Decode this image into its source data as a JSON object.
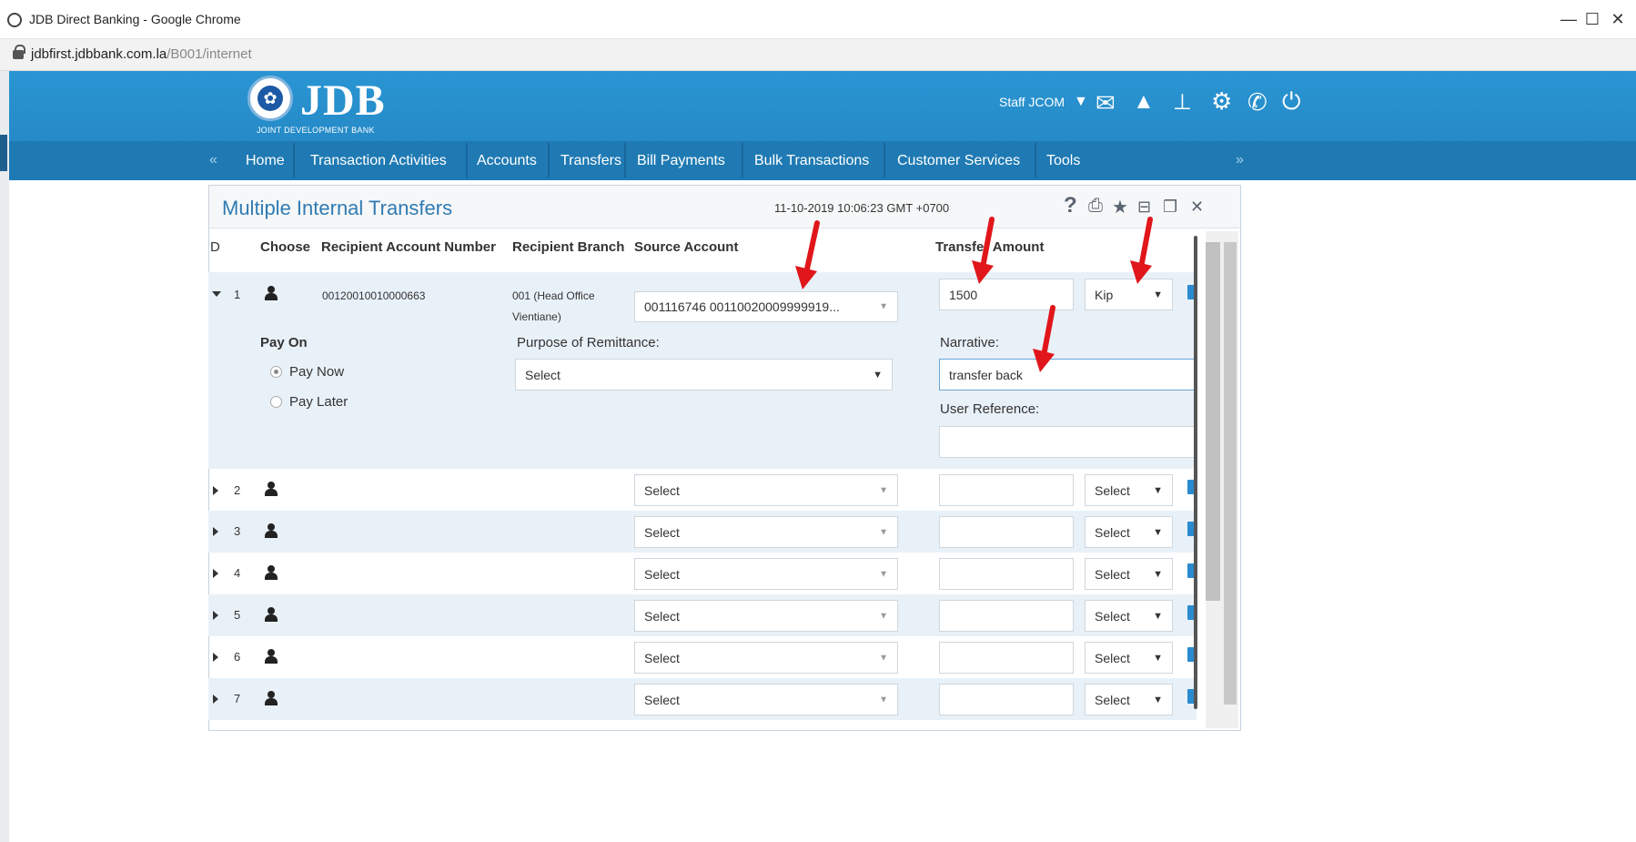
{
  "browser": {
    "title": "JDB Direct Banking - Google Chrome",
    "url_host": "jdbfirst.jdbbank.com.la",
    "url_path": "/B001/internet",
    "controls": [
      "—",
      "☐",
      "✕"
    ]
  },
  "header": {
    "logo_text": "JDB",
    "logo_subtitle": "JOINT DEVELOPMENT BANK",
    "user": "Staff JCOM",
    "icons": [
      "caret-down-icon",
      "mail-icon",
      "warning-icon",
      "sitemap-icon",
      "gear-icon",
      "phone-icon",
      "power-icon"
    ]
  },
  "menu": {
    "prev": "«",
    "next": "»",
    "items": [
      "Home",
      "Transaction Activities",
      "Accounts",
      "Transfers",
      "Bill Payments",
      "Bulk Transactions",
      "Customer Services",
      "Tools"
    ]
  },
  "panel": {
    "title": "Multiple Internal Transfers",
    "timestamp": "11-10-2019 10:06:23 GMT +0700",
    "tools": [
      "?",
      "print-icon",
      "star-icon",
      "minimize-icon",
      "window-icon",
      "close-icon"
    ]
  },
  "columns": {
    "id": "D",
    "choose": "Choose",
    "recipient_account": "Recipient Account Number",
    "recipient_branch": "Recipient Branch",
    "source_account": "Source Account",
    "transfer_amount": "Transfer Amount"
  },
  "expanded_row": {
    "num": "1",
    "recipient_account": "00120010010000663",
    "branch_line1": "001 (Head Office",
    "branch_line2": "Vientiane)",
    "source_account": "001116746 00110020009999919...",
    "amount": "1500",
    "currency": "Kip",
    "pay_on_label": "Pay On",
    "pay_now": "Pay Now",
    "pay_later": "Pay Later",
    "purpose_label": "Purpose of Remittance:",
    "purpose_value": "Select",
    "narrative_label": "Narrative:",
    "narrative_value": "transfer back",
    "user_ref_label": "User Reference:",
    "user_ref_value": ""
  },
  "rows": [
    {
      "num": "2",
      "source": "Select",
      "currency": "Select"
    },
    {
      "num": "3",
      "source": "Select",
      "currency": "Select"
    },
    {
      "num": "4",
      "source": "Select",
      "currency": "Select"
    },
    {
      "num": "5",
      "source": "Select",
      "currency": "Select"
    },
    {
      "num": "6",
      "source": "Select",
      "currency": "Select"
    },
    {
      "num": "7",
      "source": "Select",
      "currency": "Select"
    }
  ],
  "colors": {
    "header_blue": "#2a95d3",
    "menu_blue": "#1f7ab3",
    "title_blue": "#2f7bb3",
    "row_shade": "#e9f1f8",
    "annotation_red": "#e0161b"
  }
}
